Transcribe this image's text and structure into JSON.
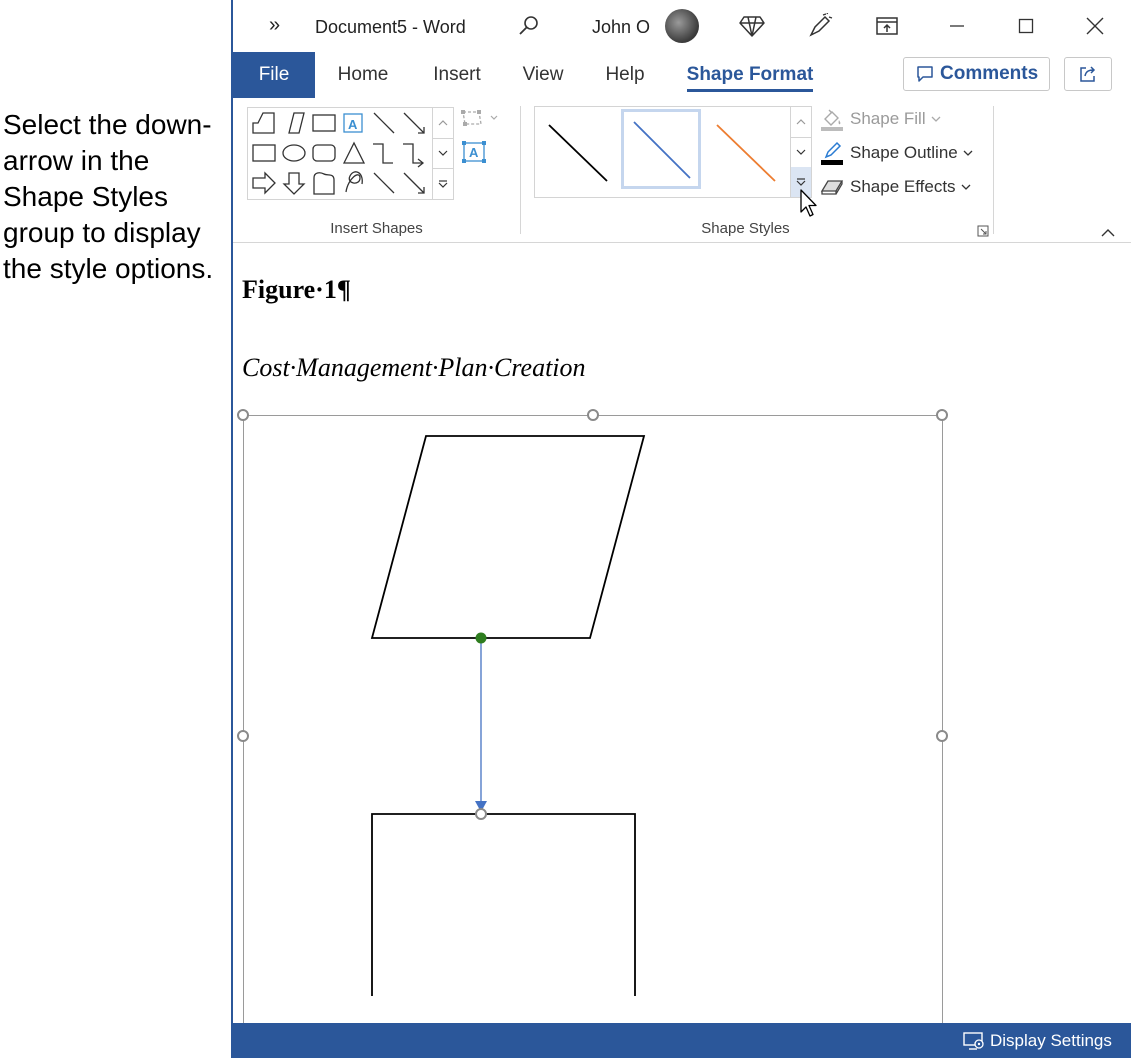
{
  "instruction": "Select the down-arrow in the Shape Styles group to display the style options.",
  "titlebar": {
    "overflow_glyph": "»",
    "doc_title": "Document5  -  Word",
    "user_name": "John O",
    "icons": [
      "search-icon",
      "diamond-icon",
      "pen-icon",
      "ribbon-display-icon"
    ],
    "minimize": "—",
    "maximize": "☐",
    "close": "✕"
  },
  "tabs": [
    {
      "label": "File"
    },
    {
      "label": "Home"
    },
    {
      "label": "Insert"
    },
    {
      "label": "View"
    },
    {
      "label": "Help"
    },
    {
      "label": "Shape Format",
      "active": true
    }
  ],
  "comments_label": "Comments",
  "ribbon": {
    "insert_shapes": {
      "label": "Insert Shapes"
    },
    "shape_styles": {
      "label": "Shape Styles",
      "commands": {
        "fill": "Shape Fill",
        "outline": "Shape Outline",
        "effects": "Shape Effects"
      },
      "style_colors": [
        "#000000",
        "#4472c4",
        "#ed7d31"
      ]
    }
  },
  "document": {
    "figure_label": "Figure·1¶",
    "figure_title": "Cost·Management·Plan·Creation"
  },
  "statusbar": {
    "display_settings": "Display Settings"
  },
  "colors": {
    "accent": "#2b579a",
    "connector": "#4472c4",
    "anchor": "#2e7d1f"
  }
}
